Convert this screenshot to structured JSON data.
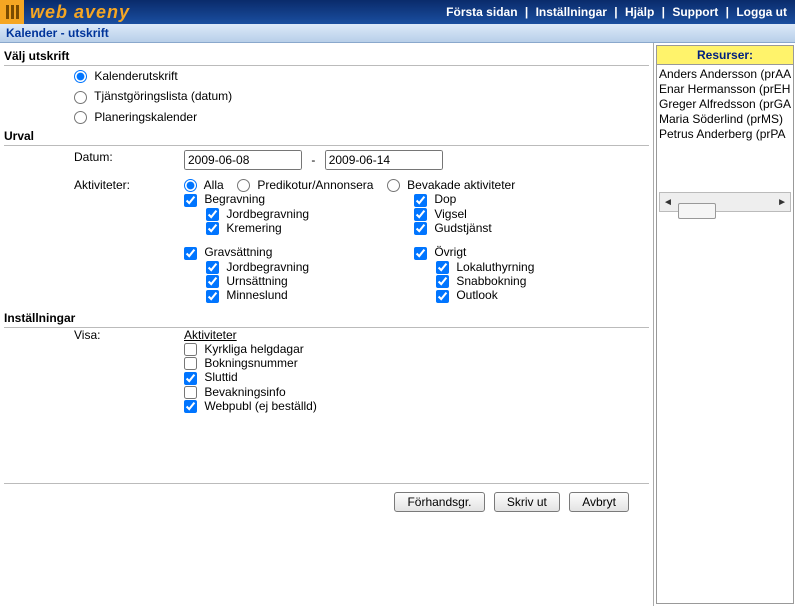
{
  "header": {
    "brand": "web aveny",
    "nav": [
      "Första sidan",
      "Inställningar",
      "Hjälp",
      "Support",
      "Logga ut"
    ],
    "sep": " | "
  },
  "title": "Kalender - utskrift",
  "sections": {
    "valj_utskrift": {
      "header": "Välj utskrift",
      "options": [
        {
          "label": "Kalenderutskrift",
          "checked": true
        },
        {
          "label": "Tjänstgöringslista (datum)",
          "checked": false
        },
        {
          "label": "Planeringskalender",
          "checked": false
        }
      ]
    },
    "urval": {
      "header": "Urval",
      "datum_label": "Datum:",
      "date_from": "2009-06-08",
      "date_sep": "-",
      "date_to": "2009-06-14",
      "akt_label": "Aktiviteter:",
      "filter_radios": [
        {
          "label": "Alla",
          "checked": true
        },
        {
          "label": "Predikotur/Annonsera",
          "checked": false
        },
        {
          "label": "Bevakade aktiviteter",
          "checked": false
        }
      ],
      "col1": {
        "g1": {
          "label": "Begravning",
          "checked": true,
          "subs": [
            {
              "label": "Jordbegravning",
              "checked": true
            },
            {
              "label": "Kremering",
              "checked": true
            }
          ]
        },
        "g2": {
          "label": "Gravsättning",
          "checked": true,
          "subs": [
            {
              "label": "Jordbegravning",
              "checked": true
            },
            {
              "label": "Urnsättning",
              "checked": true
            },
            {
              "label": "Minneslund",
              "checked": true
            }
          ]
        }
      },
      "col2": {
        "g1": {
          "items": [
            {
              "label": "Dop",
              "checked": true
            },
            {
              "label": "Vigsel",
              "checked": true
            },
            {
              "label": "Gudstjänst",
              "checked": true
            }
          ]
        },
        "g2": {
          "label": "Övrigt",
          "checked": true,
          "subs": [
            {
              "label": "Lokaluthyrning",
              "checked": true
            },
            {
              "label": "Snabbokning",
              "checked": true
            },
            {
              "label": "Outlook",
              "checked": true
            }
          ]
        }
      }
    },
    "installningar": {
      "header": "Inställningar",
      "visa_label": "Visa:",
      "link": "Aktiviteter",
      "options": [
        {
          "label": "Kyrkliga helgdagar",
          "checked": false
        },
        {
          "label": "Bokningsnummer",
          "checked": false
        },
        {
          "label": "Sluttid",
          "checked": true
        },
        {
          "label": "Bevakningsinfo",
          "checked": false
        },
        {
          "label": "Webpubl (ej beställd)",
          "checked": true
        }
      ]
    }
  },
  "buttons": {
    "preview": "Förhandsgr.",
    "print": "Skriv ut",
    "cancel": "Avbryt"
  },
  "side": {
    "header": "Resurser:",
    "items": [
      "Anders Andersson (prAA",
      "Enar Hermansson (prEH",
      "Greger Alfredsson (prGA",
      "Maria Söderlind (prMS)",
      "Petrus Anderberg (prPA"
    ]
  }
}
